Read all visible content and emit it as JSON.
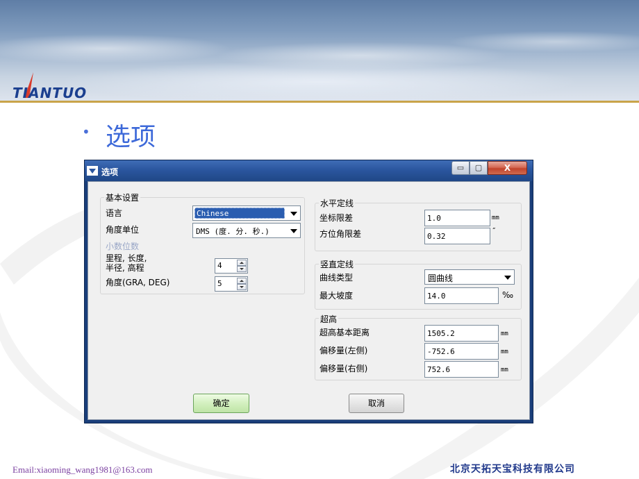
{
  "header": {
    "logo_text": "TIANTUO",
    "slide_bullet": "•",
    "slide_title": "选项"
  },
  "window": {
    "title": "选项",
    "controls": {
      "minimize": "▭",
      "maximize": "▢",
      "close": "X"
    }
  },
  "basic_settings": {
    "group_title": "基本设置",
    "language_label": "语言",
    "language_value": "Chinese",
    "angle_unit_label": "角度单位",
    "angle_unit_value": "DMS (度. 分. 秒.)",
    "decimals_label": "小数位数",
    "mileage_label_line1": "里程, 长度,",
    "mileage_label_line2": "半径, 高程",
    "mileage_value": "4",
    "angle_decimals_label": "角度(GRA, DEG)",
    "angle_decimals_value": "5"
  },
  "horizontal": {
    "group_title": "水平定线",
    "coord_tol_label": "坐标限差",
    "coord_tol_value": "1.0",
    "coord_tol_unit": "mm",
    "azimuth_tol_label": "方位角限差",
    "azimuth_tol_value": "0.32",
    "azimuth_tol_unit": "″"
  },
  "vertical": {
    "group_title": "竖直定线",
    "curve_type_label": "曲线类型",
    "curve_type_value": "圆曲线",
    "max_grade_label": "最大坡度",
    "max_grade_value": "14.0",
    "max_grade_unit": "‰"
  },
  "superelevation": {
    "group_title": "超高",
    "base_dist_label": "超高基本距离",
    "base_dist_value": "1505.2",
    "base_dist_unit": "mm",
    "offset_left_label": "偏移量(左侧)",
    "offset_left_value": "-752.6",
    "offset_left_unit": "mm",
    "offset_right_label": "偏移量(右侧)",
    "offset_right_value": "752.6",
    "offset_right_unit": "mm"
  },
  "buttons": {
    "ok": "确定",
    "cancel": "取消"
  },
  "footer": {
    "email": "Email:xiaoming_wang1981@163.com",
    "company": "北京天拓天宝科技有限公司"
  },
  "colors": {
    "title_blue": "#3d69d9",
    "window_frame": "#1a3e7a",
    "footer_company": "#223a8c"
  }
}
